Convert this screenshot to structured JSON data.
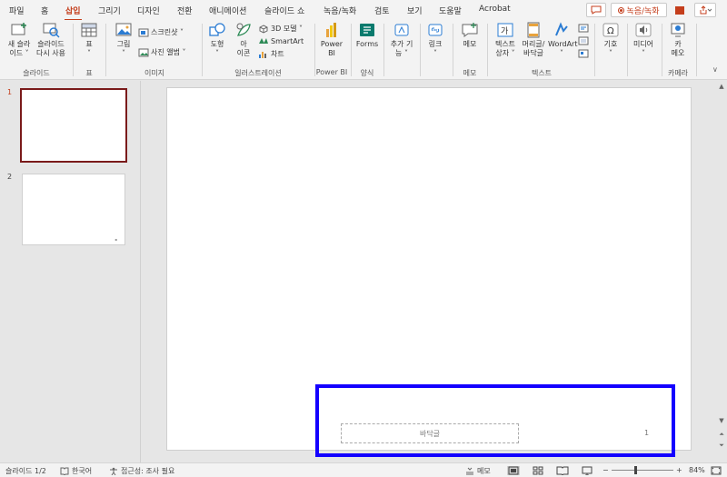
{
  "menu": {
    "tabs": [
      "파일",
      "홈",
      "삽입",
      "그리기",
      "디자인",
      "전환",
      "애니메이션",
      "슬라이드 쇼",
      "녹음/녹화",
      "검토",
      "보기",
      "도움말",
      "Acrobat"
    ],
    "active_tab": "삽입",
    "record_button": "녹음/녹화"
  },
  "ribbon": {
    "groups": {
      "slides": "슬라이드",
      "table": "표",
      "images": "이미지",
      "illustrations": "일러스트레이션",
      "powerbi": "Power BI",
      "forms": "양식",
      "comments": "메모",
      "text": "텍스트",
      "camera": "카메라"
    },
    "buttons": {
      "new_slide_1": "새 슬라",
      "new_slide_2": "이드 ˅",
      "reuse_1": "슬라이드",
      "reuse_2": "다시 사용",
      "table_1": "표",
      "table_2": "˅",
      "pictures_1": "그림",
      "pictures_2": "˅",
      "screenshot": "스크린샷 ˅",
      "photo_album": "사진 앨범 ˅",
      "shapes_1": "도형",
      "shapes_2": "˅",
      "icons_1": "아",
      "icons_2": "이콘",
      "model3d": "3D 모델 ˅",
      "smartart": "SmartArt",
      "chart": "차트",
      "powerbi_1": "Power",
      "powerbi_2": "BI",
      "forms": "Forms",
      "addins_1": "추가 기",
      "addins_2": "능 ˅",
      "link_1": "링크",
      "link_2": "˅",
      "comment": "메모",
      "textbox_1": "텍스트",
      "textbox_2": "상자 ˅",
      "headerfooter_1": "머리글/",
      "headerfooter_2": "바닥글",
      "wordart_1": "WordArt",
      "wordart_2": "˅",
      "symbols_1": "기호",
      "symbols_2": "˅",
      "media_1": "미디어",
      "media_2": "˅",
      "camera_1": "카",
      "camera_2": "메오"
    }
  },
  "thumbnails": [
    {
      "number": "1",
      "selected": true
    },
    {
      "number": "2",
      "selected": false
    }
  ],
  "slide": {
    "footer_placeholder": "바닥글",
    "page_number": "1"
  },
  "status": {
    "slide_counter": "슬라이드 1/2",
    "language": "한국어",
    "accessibility": "접근성: 조사 필요",
    "notes": "메모",
    "zoom": "84%"
  },
  "colors": {
    "accent": "#c43e1c",
    "highlight_box": "#1400ff",
    "selected_thumb_border": "#7a1a1a"
  }
}
